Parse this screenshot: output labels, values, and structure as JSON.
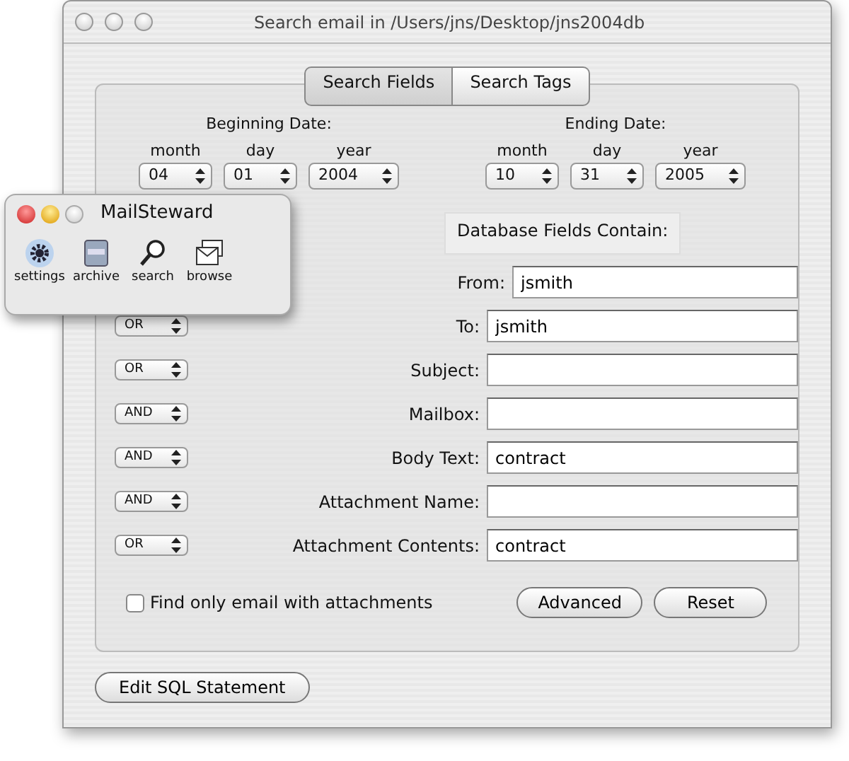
{
  "window": {
    "title": "Search email in /Users/jns/Desktop/jns2004db"
  },
  "tabs": [
    {
      "label": "Search Fields",
      "selected": true
    },
    {
      "label": "Search Tags",
      "selected": false
    }
  ],
  "beginning_date": {
    "title": "Beginning Date:",
    "parts": [
      {
        "label": "month",
        "value": "04"
      },
      {
        "label": "day",
        "value": "01"
      },
      {
        "label": "year",
        "value": "2004"
      }
    ]
  },
  "ending_date": {
    "title": "Ending Date:",
    "parts": [
      {
        "label": "month",
        "value": "10"
      },
      {
        "label": "day",
        "value": "31"
      },
      {
        "label": "year",
        "value": "2005"
      }
    ]
  },
  "fields_heading": "Database Fields Contain:",
  "fields": [
    {
      "label": "From:",
      "value": "jsmith"
    },
    {
      "operator": "OR",
      "label": "To:",
      "value": "jsmith"
    },
    {
      "operator": "OR",
      "label": "Subject:"
    },
    {
      "operator": "AND",
      "label": "Mailbox:"
    },
    {
      "operator": "AND",
      "label": "Body Text:",
      "value": "contract"
    },
    {
      "operator": "AND",
      "label": "Attachment Name:"
    },
    {
      "operator": "OR",
      "label": "Attachment Contents:",
      "value": "contract"
    }
  ],
  "attachments_checkbox": {
    "label": "Find only email with attachments",
    "checked": false
  },
  "buttons": [
    "Advanced",
    "Reset"
  ],
  "bottom_button": "Edit SQL Statement",
  "palette": {
    "title": "MailSteward",
    "tools": [
      {
        "kind": "settings",
        "label": "settings"
      },
      {
        "kind": "archive",
        "label": "archive"
      },
      {
        "kind": "search",
        "label": "search"
      },
      {
        "kind": "browse",
        "label": "browse"
      }
    ]
  }
}
